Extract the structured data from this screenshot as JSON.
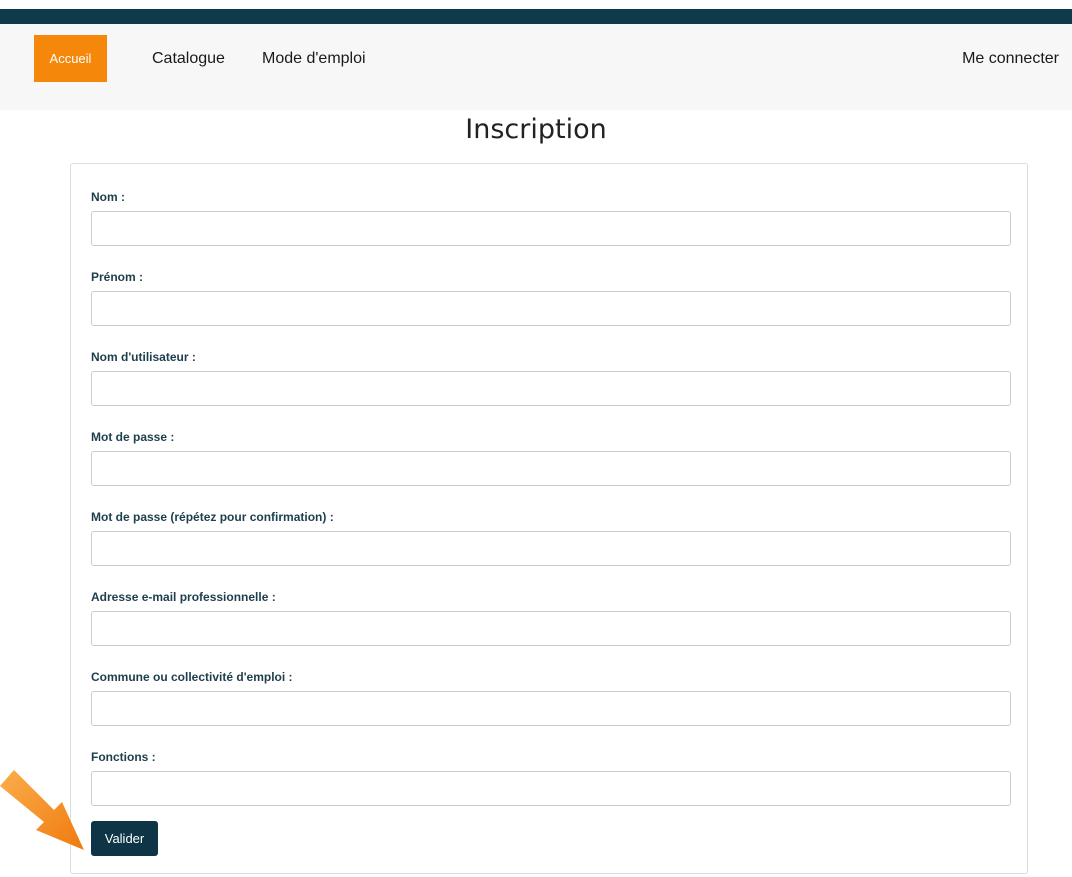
{
  "nav": {
    "items": [
      {
        "label": "Accueil"
      },
      {
        "label": "Catalogue"
      },
      {
        "label": "Mode d'emploi"
      }
    ],
    "login": "Me connecter"
  },
  "page": {
    "title": "Inscription"
  },
  "form": {
    "fields": [
      {
        "label": "Nom :",
        "value": ""
      },
      {
        "label": "Prénom :",
        "value": ""
      },
      {
        "label": "Nom d'utilisateur :",
        "value": ""
      },
      {
        "label": "Mot de passe :",
        "value": ""
      },
      {
        "label": "Mot de passe (répétez pour confirmation) :",
        "value": ""
      },
      {
        "label": "Adresse e-mail professionnelle :",
        "value": ""
      },
      {
        "label": "Commune ou collectivité d'emploi :",
        "value": ""
      },
      {
        "label": "Fonctions :",
        "value": ""
      }
    ],
    "submit_label": "Valider"
  },
  "colors": {
    "topbar": "#0f3a4a",
    "accent": "#f5870a",
    "button": "#0d3545",
    "label": "#1d3e4c"
  },
  "annotations": {
    "arrow_icon": "pointer-arrow-icon"
  }
}
